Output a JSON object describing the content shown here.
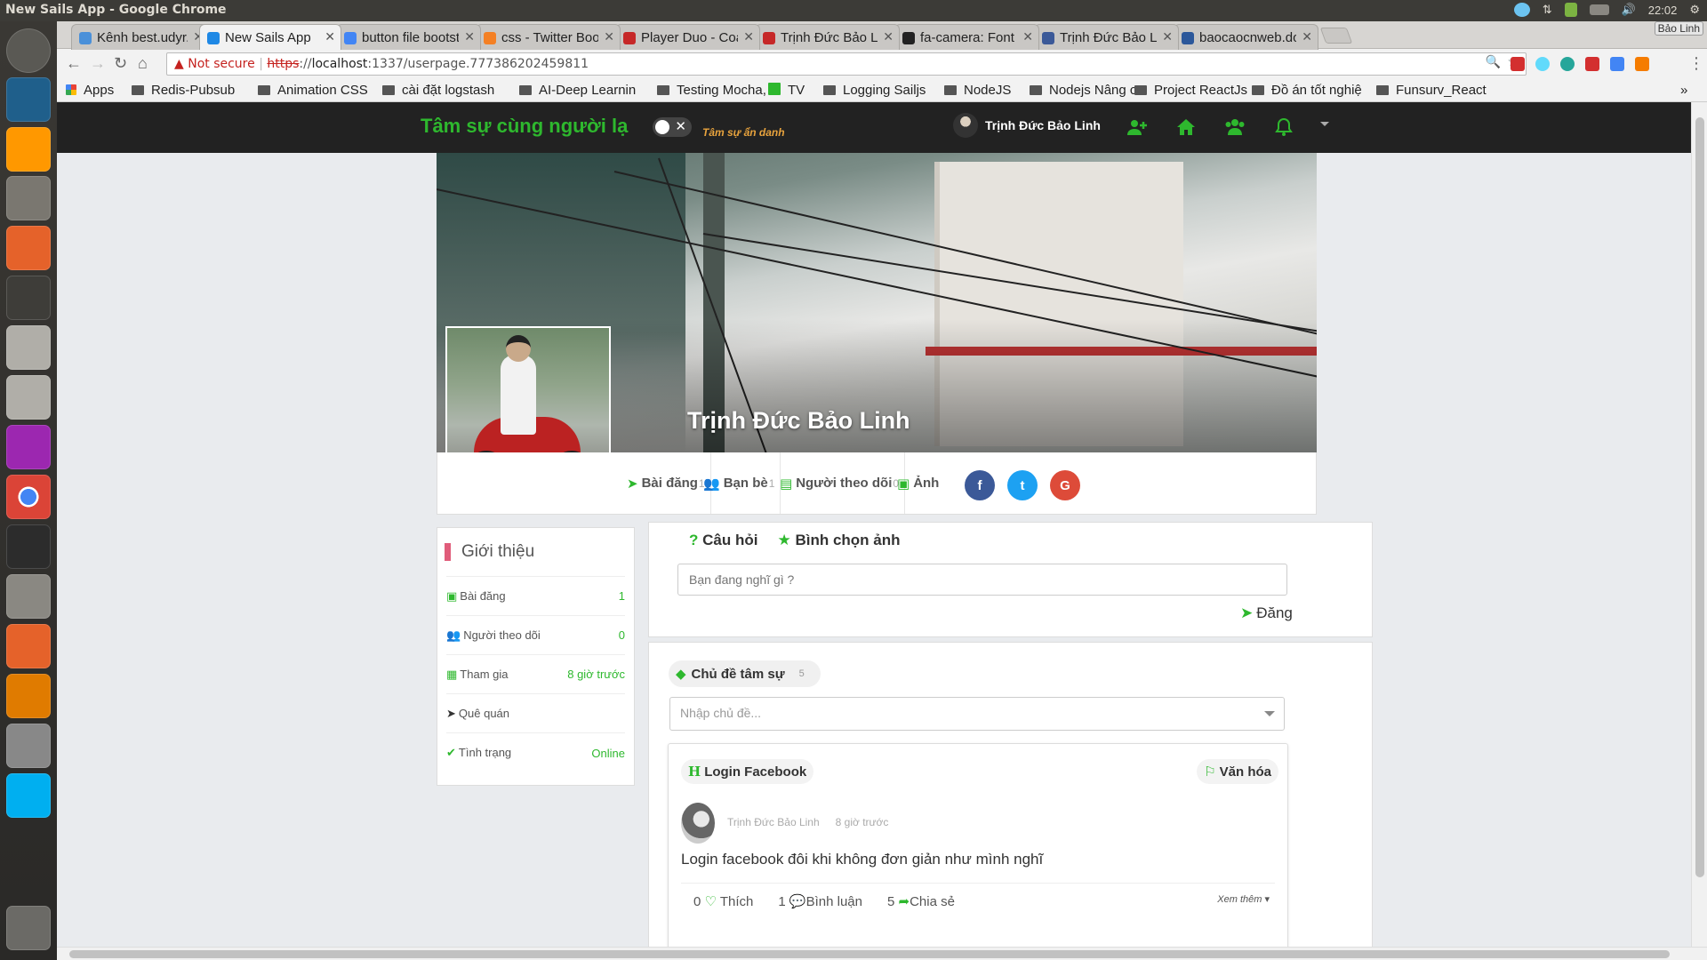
{
  "os": {
    "window_title": "New Sails App - Google Chrome",
    "clock": "22:02",
    "user": "Bảo Linh"
  },
  "tabs": [
    {
      "label": "Kênh best.udyr.v",
      "color": "#4a90d9"
    },
    {
      "label": "New Sails App",
      "color": "#1e88e5"
    },
    {
      "label": "button file bootstra",
      "color": "#4285f4"
    },
    {
      "label": "css - Twitter Bootst",
      "color": "#f48024"
    },
    {
      "label": "Player Duo - Coachi",
      "color": "#c62828"
    },
    {
      "label": "Trịnh Đức Bảo Linh",
      "color": "#c62828"
    },
    {
      "label": "fa-camera: Font Aw",
      "color": "#222222"
    },
    {
      "label": "Trịnh Đức Bảo Linh",
      "color": "#3b5998"
    },
    {
      "label": "baocaocnweb.docx",
      "color": "#2b579a"
    }
  ],
  "address": {
    "not_secure": "Not secure",
    "scheme": "https",
    "host": "localhost",
    "rest": ":1337/userpage.777386202459811"
  },
  "bookmarks": [
    "Apps",
    "Redis-Pubsub",
    "Animation CSS",
    "cài đặt logstash",
    "AI-Deep Learnin",
    "Testing Mocha,",
    "TV",
    "Logging Sailjs",
    "NodeJS",
    "Nodejs Nâng ca",
    "Project ReactJs",
    "Đồ án tốt nghiệ",
    "Funsurv_React"
  ],
  "navbar": {
    "brand": "Tâm sự cùng người lạ",
    "anon_label": "Tâm sự ẩn danh",
    "username": "Trịnh Đức Bảo Linh"
  },
  "profile": {
    "name": "Trịnh Đức Bảo Linh",
    "tabs": [
      {
        "label": "Bài đăng",
        "count": "1"
      },
      {
        "label": "Bạn bè",
        "count": "1"
      },
      {
        "label": "Người theo dõi",
        "count": "0"
      },
      {
        "label": "Ảnh",
        "count": ""
      }
    ]
  },
  "intro": {
    "title": "Giới thiệu",
    "rows": [
      {
        "label": "Bài đăng",
        "value": "1"
      },
      {
        "label": "Người theo dõi",
        "value": "0"
      },
      {
        "label": "Tham gia",
        "value": "8 giờ trước"
      },
      {
        "label": "Quê quán",
        "value": ""
      },
      {
        "label": "Tình trạng",
        "value": "Online"
      }
    ]
  },
  "composer": {
    "tab_question": "Câu hỏi",
    "tab_vote": "Bình chọn ảnh",
    "placeholder": "Bạn đang nghĩ gì ?",
    "post_label": "Đăng"
  },
  "feed": {
    "topic_label": "Chủ đề tâm sự",
    "topic_count": "5",
    "topic_placeholder": "Nhập chủ đề...",
    "post": {
      "tag": "Login Facebook",
      "category": "Văn hóa",
      "author": "Trịnh Đức Bảo Linh",
      "time": "8 giờ trước",
      "text": "Login facebook đôi khi không đơn giản như mình nghĩ",
      "likes": "0",
      "like_label": "Thích",
      "comments": "1",
      "comment_label": "Bình luận",
      "shares": "5",
      "share_label": "Chia sẻ",
      "more_label": "Xem thêm"
    }
  }
}
